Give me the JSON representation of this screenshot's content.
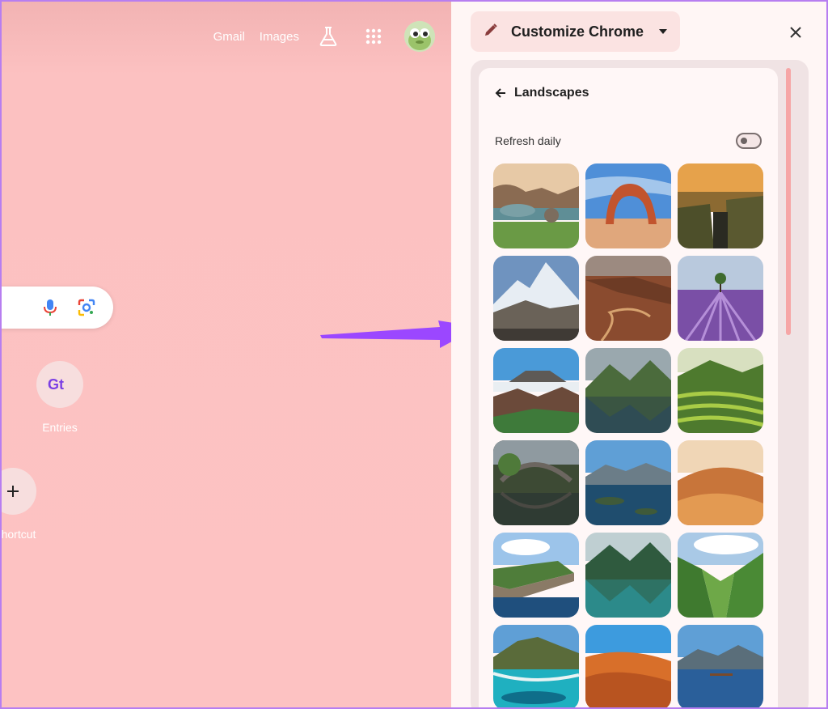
{
  "ntp": {
    "top_links": {
      "gmail": "Gmail",
      "images": "Images"
    },
    "icons": {
      "labs": "labs-flask-icon",
      "apps": "apps-grid-icon",
      "avatar": "profile-avatar"
    },
    "search": {
      "mic_icon": "microphone-icon",
      "lens_icon": "google-lens-icon"
    },
    "shortcuts": [
      {
        "label": "Entries",
        "icon": "gt-logo-icon"
      },
      {
        "label": "hortcut",
        "icon": "plus-icon"
      }
    ]
  },
  "panel": {
    "title": "Customize Chrome",
    "section": "Landscapes",
    "refresh_label": "Refresh daily",
    "refresh_daily_on": false,
    "thumbnails": [
      "coastal-rocks",
      "delicate-arch",
      "canyon-cliffs",
      "snow-mountains",
      "red-canyon-road",
      "lavender-field",
      "volcano-crater",
      "mountain-lake",
      "rice-terraces",
      "stone-bridge",
      "lake-islands",
      "desert-dune",
      "sea-cliffs",
      "emerald-lake",
      "green-valley",
      "tropical-island",
      "orange-dunes",
      "mountain-reflection"
    ]
  },
  "colors": {
    "ntp_background": "#fdc2c2",
    "panel_background": "#fff6f5",
    "accent_arrow": "#9b47ff"
  }
}
